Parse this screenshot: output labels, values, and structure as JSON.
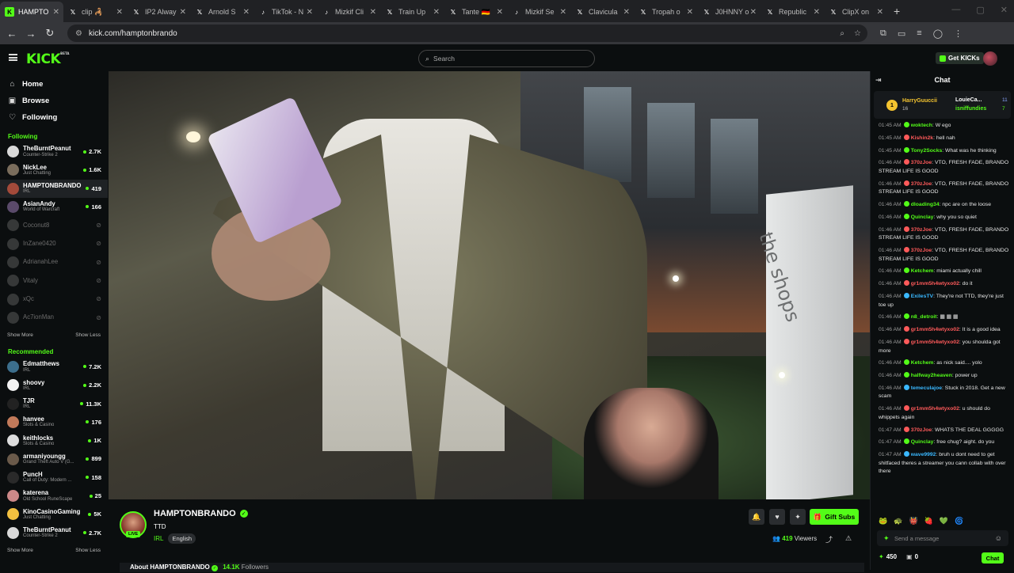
{
  "tabs": [
    {
      "label": "HAMPTO",
      "fav_bg": "#53fc18",
      "fav_fg": "#000",
      "fav": "K",
      "active": true
    },
    {
      "label": "clip 🦂",
      "fav_bg": "#202124",
      "fav_fg": "#fff",
      "fav": "𝕏"
    },
    {
      "label": "IP2 Alway",
      "fav_bg": "#202124",
      "fav_fg": "#fff",
      "fav": "𝕏"
    },
    {
      "label": "Arnold S",
      "fav_bg": "#202124",
      "fav_fg": "#fff",
      "fav": "𝕏"
    },
    {
      "label": "TikTok - N",
      "fav_bg": "#202124",
      "fav_fg": "#fff",
      "fav": "♪"
    },
    {
      "label": "Mizkif Cli",
      "fav_bg": "#202124",
      "fav_fg": "#fff",
      "fav": "♪"
    },
    {
      "label": "Train Up",
      "fav_bg": "#202124",
      "fav_fg": "#fff",
      "fav": "𝕏"
    },
    {
      "label": "Tante 🇩🇪",
      "fav_bg": "#202124",
      "fav_fg": "#fff",
      "fav": "𝕏"
    },
    {
      "label": "Mizkif Se",
      "fav_bg": "#202124",
      "fav_fg": "#fff",
      "fav": "♪"
    },
    {
      "label": "Clavicula",
      "fav_bg": "#202124",
      "fav_fg": "#fff",
      "fav": "𝕏"
    },
    {
      "label": "Tropah o",
      "fav_bg": "#202124",
      "fav_fg": "#fff",
      "fav": "𝕏"
    },
    {
      "label": "J0HNNY o",
      "fav_bg": "#202124",
      "fav_fg": "#fff",
      "fav": "𝕏"
    },
    {
      "label": "Republic",
      "fav_bg": "#202124",
      "fav_fg": "#fff",
      "fav": "𝕏"
    },
    {
      "label": "ClipX on",
      "fav_bg": "#202124",
      "fav_fg": "#fff",
      "fav": "𝕏"
    }
  ],
  "browser": {
    "url": "kick.com/hamptonbrando"
  },
  "header": {
    "logo": "KICK",
    "logo_sup": "BETA",
    "search_placeholder": "Search",
    "get_kicks": "Get KICKs"
  },
  "sidebar": {
    "nav": [
      {
        "label": "Home",
        "icon": "⌂"
      },
      {
        "label": "Browse",
        "icon": "▣"
      },
      {
        "label": "Following",
        "icon": "♡"
      }
    ],
    "following_title": "Following",
    "following": [
      {
        "name": "TheBurntPeanut",
        "cat": "Counter-Strike 2",
        "viewers": "2.7K",
        "color": "#d9d9d9"
      },
      {
        "name": "NickLee",
        "cat": "Just Chatting",
        "viewers": "1.6K",
        "color": "#7a6d5c"
      },
      {
        "name": "HAMPTONBRANDO",
        "cat": "IRL",
        "viewers": "419",
        "color": "#a34a3a",
        "sel": true
      },
      {
        "name": "AsianAndy",
        "cat": "World of Warcraft",
        "viewers": "166",
        "color": "#5a4a6a"
      },
      {
        "name": "Coconut8",
        "off": true,
        "color": "#888"
      },
      {
        "name": "InZane0420",
        "off": true,
        "color": "#888"
      },
      {
        "name": "AdrianahLee",
        "off": true,
        "color": "#888"
      },
      {
        "name": "Vitaly",
        "off": true,
        "color": "#888"
      },
      {
        "name": "xQc",
        "off": true,
        "color": "#888"
      },
      {
        "name": "Ac7ionMan",
        "off": true,
        "color": "#888"
      }
    ],
    "show_more": "Show More",
    "show_less": "Show Less",
    "recommended_title": "Recommended",
    "recommended": [
      {
        "name": "Edmatthews",
        "cat": "IRL",
        "viewers": "7.2K",
        "color": "#3c6e8c"
      },
      {
        "name": "shoovy",
        "cat": "IRL",
        "viewers": "2.2K",
        "color": "#f2f2f2"
      },
      {
        "name": "TJR",
        "cat": "IRL",
        "viewers": "11.3K",
        "color": "#222"
      },
      {
        "name": "hanvee",
        "cat": "Slots & Casino",
        "viewers": "176",
        "color": "#c27a5a"
      },
      {
        "name": "keithlocks",
        "cat": "Slots & Casino",
        "viewers": "1K",
        "color": "#ddd"
      },
      {
        "name": "armaniyoungg",
        "cat": "Grand Theft Auto V (G...",
        "viewers": "899",
        "color": "#6a5a4a"
      },
      {
        "name": "PuncH",
        "cat": "Call of Duty: Modern ...",
        "viewers": "158",
        "color": "#2a2a2a"
      },
      {
        "name": "katerena",
        "cat": "Old School RuneScape",
        "viewers": "25",
        "color": "#c88"
      },
      {
        "name": "KinoCasinoGaming",
        "cat": "Just Chatting",
        "viewers": "5K",
        "color": "#f2c040"
      },
      {
        "name": "TheBurntPeanut",
        "cat": "Counter-Strike 2",
        "viewers": "2.7K",
        "color": "#d9d9d9"
      }
    ]
  },
  "channel": {
    "name": "HAMPTONBRANDO",
    "live": "LIVE",
    "title": "TTD",
    "category": "IRL",
    "tag": "English",
    "viewers": "419",
    "viewers_label": "Viewers",
    "gift_subs": "Gift Subs",
    "about": "About HAMPTONBRANDO",
    "followers": "14.1K",
    "followers_label": "Followers",
    "video_sign": "the shops"
  },
  "chat": {
    "title": "Chat",
    "pinned": {
      "rank": "1",
      "user1": "HarryGuuccii",
      "user1_sub": "16",
      "user2": "LouieCa...",
      "user2_count": "11",
      "user3": "isniffundies",
      "user3_count": "7"
    },
    "messages": [
      {
        "ts": "01:45 AM",
        "user": "woktech",
        "color": "#53fc18",
        "text": "W ego"
      },
      {
        "ts": "01:45 AM",
        "user": "Kishin2k",
        "color": "#ff5a5a",
        "text": "hell nah"
      },
      {
        "ts": "01:45 AM",
        "user": "Tony2Socks",
        "color": "#53fc18",
        "text": "What was he thinking"
      },
      {
        "ts": "01:46 AM",
        "user": "370zJoe",
        "color": "#ff5a5a",
        "text": "VTO, FRESH FADE, BRANDO STREAM LIFE IS GOOD"
      },
      {
        "ts": "01:46 AM",
        "user": "370zJoe",
        "color": "#ff5a5a",
        "text": "VTO, FRESH FADE, BRANDO STREAM LIFE IS GOOD"
      },
      {
        "ts": "01:46 AM",
        "user": "dloading34",
        "color": "#53fc18",
        "text": "npc are on the loose"
      },
      {
        "ts": "01:46 AM",
        "user": "Quinclay",
        "color": "#53fc18",
        "text": "why you so quiet"
      },
      {
        "ts": "01:46 AM",
        "user": "370zJoe",
        "color": "#ff5a5a",
        "text": "VTO, FRESH FADE, BRANDO STREAM LIFE IS GOOD"
      },
      {
        "ts": "01:46 AM",
        "user": "370zJoe",
        "color": "#ff5a5a",
        "text": "VTO, FRESH FADE, BRANDO STREAM LIFE IS GOOD"
      },
      {
        "ts": "01:46 AM",
        "user": "Ketchem",
        "color": "#53fc18",
        "text": "miami actually chill"
      },
      {
        "ts": "01:46 AM",
        "user": "gr1mm5h4wtyxo02",
        "color": "#ff5a5a",
        "text": "do it"
      },
      {
        "ts": "01:46 AM",
        "user": "ExilesTV",
        "color": "#3ab8ff",
        "text": "They're not TTD, they're just toe up"
      },
      {
        "ts": "01:46 AM",
        "user": "n8_detroit",
        "color": "#53fc18",
        "text": "▦ ▦ ▦"
      },
      {
        "ts": "01:46 AM",
        "user": "gr1mm5h4wtyxo02",
        "color": "#ff5a5a",
        "text": "It is a good idea"
      },
      {
        "ts": "01:46 AM",
        "user": "gr1mm5h4wtyxo02",
        "color": "#ff5a5a",
        "text": "you shoulda got more"
      },
      {
        "ts": "01:46 AM",
        "user": "Ketchem",
        "color": "#53fc18",
        "text": "as nick said.... yolo"
      },
      {
        "ts": "01:46 AM",
        "user": "halfway2heaven",
        "color": "#53fc18",
        "text": "power up"
      },
      {
        "ts": "01:46 AM",
        "user": "temeculajoe",
        "color": "#3ab8ff",
        "text": "Stuck in 2018. Get a new scam"
      },
      {
        "ts": "01:46 AM",
        "user": "gr1mm5h4wtyxo02",
        "color": "#ff5a5a",
        "text": "u should do whippets again"
      },
      {
        "ts": "01:47 AM",
        "user": "370zJoe",
        "color": "#ff5a5a",
        "text": "WHATS THE DEAL GGGGG"
      },
      {
        "ts": "01:47 AM",
        "user": "Quinclay",
        "color": "#53fc18",
        "text": "free chug? aight. do you"
      },
      {
        "ts": "01:47 AM",
        "user": "wave9992",
        "color": "#3ab8ff",
        "text": "bruh u dont need to get shitfaced theres a streamer you cann collab with over there"
      }
    ],
    "input_placeholder": "Send a message",
    "kicks": "450",
    "gifts": "0",
    "send": "Chat"
  }
}
